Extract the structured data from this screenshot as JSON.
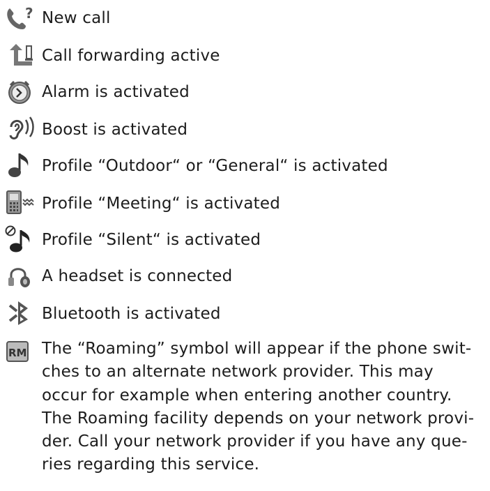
{
  "items": [
    {
      "icon": "new-call-icon",
      "label": "New call"
    },
    {
      "icon": "call-forwarding-icon",
      "label": "Call forwarding active"
    },
    {
      "icon": "alarm-clock-icon",
      "label": "Alarm is activated"
    },
    {
      "icon": "boost-ear-icon",
      "label": "Boost is activated"
    },
    {
      "icon": "music-note-icon",
      "label": "Profile “Outdoor“ or “General“ is activated"
    },
    {
      "icon": "meeting-phone-icon",
      "label": "Profile “Meeting“ is activated"
    },
    {
      "icon": "silent-note-icon",
      "label": "Profile “Silent“ is activated"
    },
    {
      "icon": "headset-icon",
      "label": "A headset is connected"
    },
    {
      "icon": "bluetooth-icon",
      "label": "Bluetooth is activated"
    }
  ],
  "roaming": {
    "icon": "roaming-rm-icon",
    "lines": [
      "The “Roaming” symbol will appear if the phone swit-",
      "ches to an alternate network provider. This may",
      "occur for example when entering another country.",
      "The Roaming facility depends on your network provi-",
      "der. Call your network provider if you have any que-",
      "ries regarding this service."
    ]
  }
}
